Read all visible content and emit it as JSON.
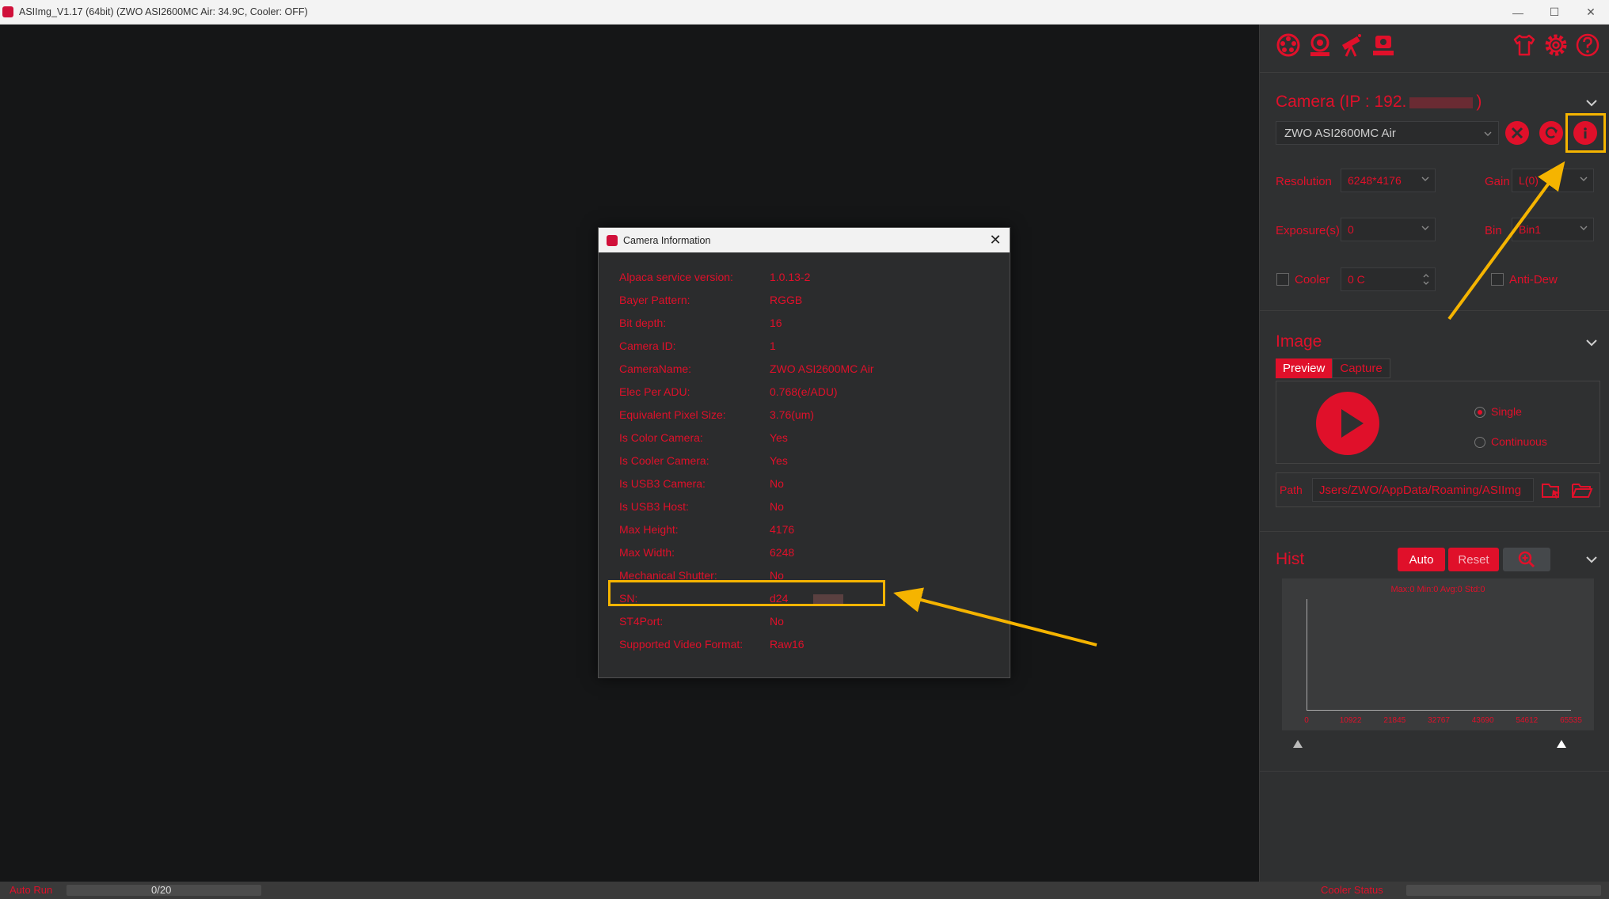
{
  "window": {
    "title": "ASIImg_V1.17 (64bit)  (ZWO ASI2600MC Air: 34.9C, Cooler: OFF)",
    "minimize": "—",
    "maximize": "☐",
    "close": "✕"
  },
  "toolbar": {
    "icons": [
      "aperture-icon",
      "camera-connect-icon",
      "telescope-icon",
      "camera-station-icon",
      "skin-shirt-icon",
      "settings-gear-icon",
      "help-icon"
    ]
  },
  "camera": {
    "section_title": "Camera (IP : 192.",
    "section_title_suffix": ")",
    "selected_camera": "ZWO ASI2600MC Air",
    "resolution_label": "Resolution",
    "resolution_value": "6248*4176",
    "gain_label": "Gain",
    "gain_value": "L(0)",
    "exposure_label": "Exposure(s)",
    "exposure_value": "0",
    "bin_label": "Bin",
    "bin_value": "Bin1",
    "cooler_label": "Cooler",
    "cooler_value": "0 C",
    "antidew_label": "Anti-Dew"
  },
  "image": {
    "section_title": "Image",
    "tab_preview": "Preview",
    "tab_capture": "Capture",
    "mode_single": "Single",
    "mode_continuous": "Continuous",
    "path_label": "Path",
    "path_value": "Jsers/ZWO/AppData/Roaming/ASIImg"
  },
  "hist": {
    "section_title": "Hist",
    "auto_label": "Auto",
    "reset_label": "Reset",
    "legend": "Max:0 Min:0 Avg:0 Std:0",
    "x_ticks": [
      "0",
      "10922",
      "21845",
      "32767",
      "43690",
      "54612",
      "65535"
    ]
  },
  "status": {
    "auto_run_label": "Auto Run",
    "progress_text": "0/20",
    "progress_fraction": 0,
    "cooler_status_label": "Cooler Status"
  },
  "dialog": {
    "title": "Camera Information",
    "close": "✕",
    "rows": [
      {
        "key": "Alpaca service version:",
        "value": "1.0.13-2"
      },
      {
        "key": "Bayer Pattern:",
        "value": "RGGB"
      },
      {
        "key": "Bit depth:",
        "value": "16"
      },
      {
        "key": "Camera ID:",
        "value": "1"
      },
      {
        "key": "CameraName:",
        "value": "ZWO ASI2600MC Air"
      },
      {
        "key": "Elec Per ADU:",
        "value": "0.768(e/ADU)"
      },
      {
        "key": "Equivalent Pixel Size:",
        "value": "3.76(um)"
      },
      {
        "key": "Is Color Camera:",
        "value": "Yes"
      },
      {
        "key": "Is Cooler Camera:",
        "value": "Yes"
      },
      {
        "key": "Is USB3 Camera:",
        "value": "No"
      },
      {
        "key": "Is USB3 Host:",
        "value": "No"
      },
      {
        "key": "Max Height:",
        "value": "4176"
      },
      {
        "key": "Max Width:",
        "value": "6248"
      },
      {
        "key": "Mechanical Shutter:",
        "value": "No"
      },
      {
        "key": "SN:",
        "value": "d24"
      },
      {
        "key": "ST4Port:",
        "value": "No"
      },
      {
        "key": "Supported Video Format:",
        "value": "Raw16"
      }
    ]
  },
  "colors": {
    "accent": "#e0102a",
    "annotation": "#f5b400",
    "panel": "#2f3031",
    "canvas": "#151617"
  }
}
